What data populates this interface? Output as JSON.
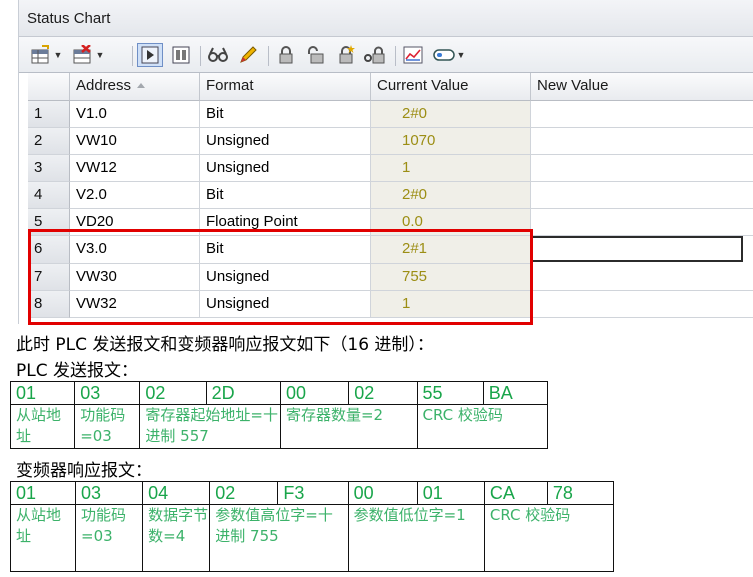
{
  "window": {
    "title": "Status Chart"
  },
  "table": {
    "headers": {
      "index": "",
      "address": "Address",
      "format": "Format",
      "current_value": "Current Value",
      "new_value": "New Value"
    },
    "rows": [
      {
        "num": "1",
        "address": "V1.0",
        "format": "Bit",
        "current": "2#0",
        "new": ""
      },
      {
        "num": "2",
        "address": "VW10",
        "format": "Unsigned",
        "current": "1070",
        "new": ""
      },
      {
        "num": "3",
        "address": "VW12",
        "format": "Unsigned",
        "current": "1",
        "new": ""
      },
      {
        "num": "4",
        "address": "V2.0",
        "format": "Bit",
        "current": "2#0",
        "new": ""
      },
      {
        "num": "5",
        "address": "VD20",
        "format": "Floating Point",
        "current": "0.0",
        "new": ""
      },
      {
        "num": "6",
        "address": "V3.0",
        "format": "Bit",
        "current": "2#1",
        "new": ""
      },
      {
        "num": "7",
        "address": "VW30",
        "format": "Unsigned",
        "current": "755",
        "new": ""
      },
      {
        "num": "8",
        "address": "VW32",
        "format": "Unsigned",
        "current": "1",
        "new": ""
      }
    ]
  },
  "text": {
    "intro": "此时 PLC 发送报文和变频器响应报文如下（16 进制）：",
    "plc_label": "PLC 发送报文：",
    "vfd_label": "变频器响应报文："
  },
  "plc_frame": {
    "bytes": [
      "01",
      "03",
      "02",
      "2D",
      "00",
      "02",
      "55",
      "BA"
    ],
    "desc": [
      "从站地址",
      "功能码=03",
      "寄存器起始地址=十进制 557",
      "寄存器数量=2",
      "CRC 校验码"
    ]
  },
  "vfd_frame": {
    "bytes": [
      "01",
      "03",
      "04",
      "02",
      "F3",
      "00",
      "01",
      "CA",
      "78"
    ],
    "desc": [
      "从站地址",
      "功能码=03",
      "数据字节数=4",
      "参数值高位字=十进制 755",
      "参数值低位字=1",
      "CRC 校验码"
    ]
  },
  "colors": {
    "highlight_border": "#e10000",
    "hex_text": "#19a54a",
    "desc_text": "#3cb26a",
    "current_value_text": "#9c8e14"
  }
}
